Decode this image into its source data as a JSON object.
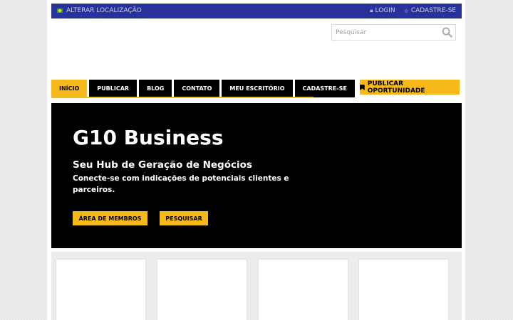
{
  "topbar": {
    "location_label": "ALTERAR LOCALIZAÇÃO",
    "location_icon": "brazil-flag-icon",
    "login_label": "LOGIN",
    "login_icon": "lock-icon",
    "signup_label": "CADASTRE-SE",
    "signup_icon": "star-icon",
    "bg_color": "#27339b"
  },
  "search": {
    "placeholder": "Pesquisar",
    "icon": "search-icon"
  },
  "nav": {
    "items": [
      {
        "label": "INÍCIO"
      },
      {
        "label": "PUBLICAR"
      },
      {
        "label": "BLOG"
      },
      {
        "label": "CONTATO"
      },
      {
        "label": "MEU ESCRITÓRIO"
      },
      {
        "label": "CADASTRE-SE"
      }
    ],
    "active": "INÍCIO",
    "cta_label": "PUBLICAR OPORTUNIDADE",
    "cta_icon": "bookmark-icon",
    "accent_color": "#f5b91c"
  },
  "hero": {
    "title": "G10 Business",
    "subtitle": "Seu Hub de Geração de Negócios",
    "description": "Conecte-se com indicações de potenciais clientes e parceiros.",
    "members_button": "ÁREA DE MEMBROS",
    "search_button": "PESQUISAR"
  }
}
